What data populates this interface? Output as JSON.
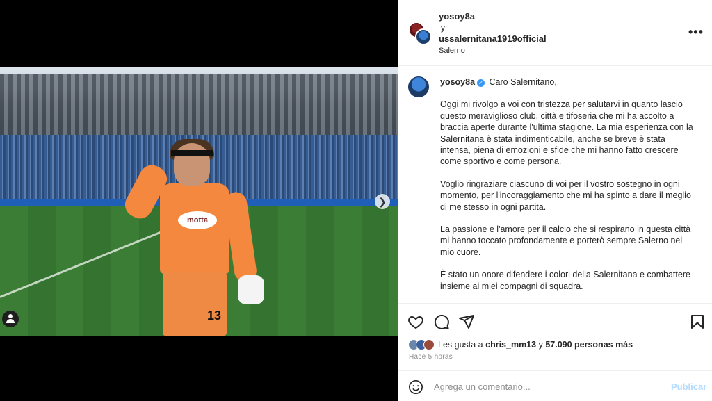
{
  "header": {
    "user1": "yosoy8a",
    "connector": "y",
    "user2": "ussalernitana1919official",
    "location": "Salerno",
    "more_icon": "more-horizontal-icon"
  },
  "media": {
    "sponsor": "motta",
    "jersey_number": "13",
    "carousel_dots": 8,
    "active_dot": 0,
    "next_icon": "chevron-right-icon",
    "tag_icon": "user-tag-icon"
  },
  "caption": {
    "username": "yosoy8a",
    "verified_icon": "verified-badge-icon",
    "greeting": "Caro Salernitano,",
    "paragraphs": [
      "Oggi mi rivolgo a voi con tristezza per salutarvi in quanto lascio questo meraviglioso club, città e tifoseria che mi ha accolto a braccia aperte durante l'ultima stagione. La mia esperienza con la Salernitana è stata indimenticabile, anche se breve è stata intensa, piena di emozioni e sfide che mi hanno fatto crescere come sportivo e come persona.",
      "Voglio ringraziare ciascuno di voi per il vostro sostegno in ogni momento, per l'incoraggiamento che mi ha spinto a dare il meglio di me stesso in ogni partita.",
      "La passione e l'amore per il calcio che si respirano in questa città mi hanno toccato profondamente e porterò sempre Salerno nel mio cuore.",
      "È stato un onore difendere i colori della Salernitana e combattere insieme ai miei compagni di squadra."
    ]
  },
  "actions": {
    "like_icon": "heart-icon",
    "comment_icon": "comment-icon",
    "share_icon": "send-icon",
    "save_icon": "bookmark-icon"
  },
  "likes": {
    "prefix": "Les gusta a",
    "user": "chris_mm13",
    "joiner": "y",
    "others": "57.090 personas más"
  },
  "time": "Hace 5 horas",
  "comment": {
    "emoji_icon": "emoji-icon",
    "placeholder": "Agrega un comentario...",
    "publish_label": "Publicar"
  },
  "colors": {
    "accent": "#0095f6",
    "publish_disabled": "#b3dbff",
    "border": "#efefef",
    "muted": "#8e8e8e"
  }
}
